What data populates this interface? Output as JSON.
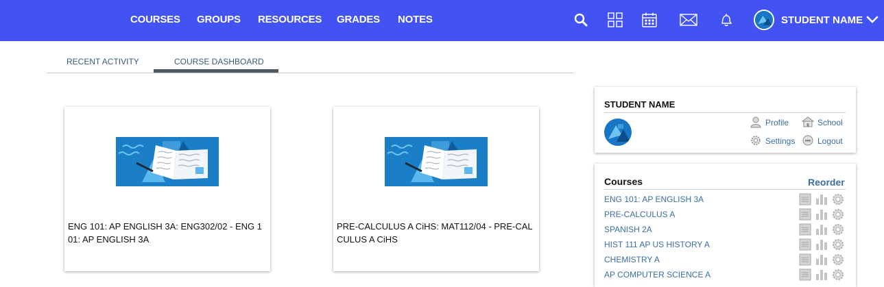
{
  "nav": {
    "links": [
      "COURSES",
      "GROUPS",
      "RESOURCES",
      "GRADES",
      "NOTES"
    ],
    "user_name": "STUDENT NAME",
    "icons": [
      "search-icon",
      "apps-grid-icon",
      "calendar-icon",
      "mail-icon",
      "bell-icon"
    ]
  },
  "tabs": {
    "recent": "RECENT ACTIVITY",
    "dashboard": "COURSE DASHBOARD"
  },
  "cards": [
    {
      "title": "ENG 101: AP ENGLISH 3A: ENG302/02 - ENG 101: AP ENGLISH 3A"
    },
    {
      "title": "PRE-CALCULUS A CiHS: MAT112/04 - PRE-CALCULUS A CiHS"
    }
  ],
  "profile_panel": {
    "name": "STUDENT NAME",
    "profile": "Profile",
    "school": "School",
    "settings": "Settings",
    "logout": "Logout"
  },
  "courses_panel": {
    "heading": "Courses",
    "reorder": "Reorder",
    "items": [
      "ENG 101: AP ENGLISH 3A",
      "PRE-CALCULUS A",
      "SPANISH 2A",
      "HIST 111 AP US HISTORY A",
      "CHEMISTRY A",
      "AP COMPUTER SCIENCE A"
    ]
  },
  "colors": {
    "nav_bg": "#4353f3",
    "link_blue": "#3a6ea5",
    "card_img_bg": "#1a7fc7"
  }
}
